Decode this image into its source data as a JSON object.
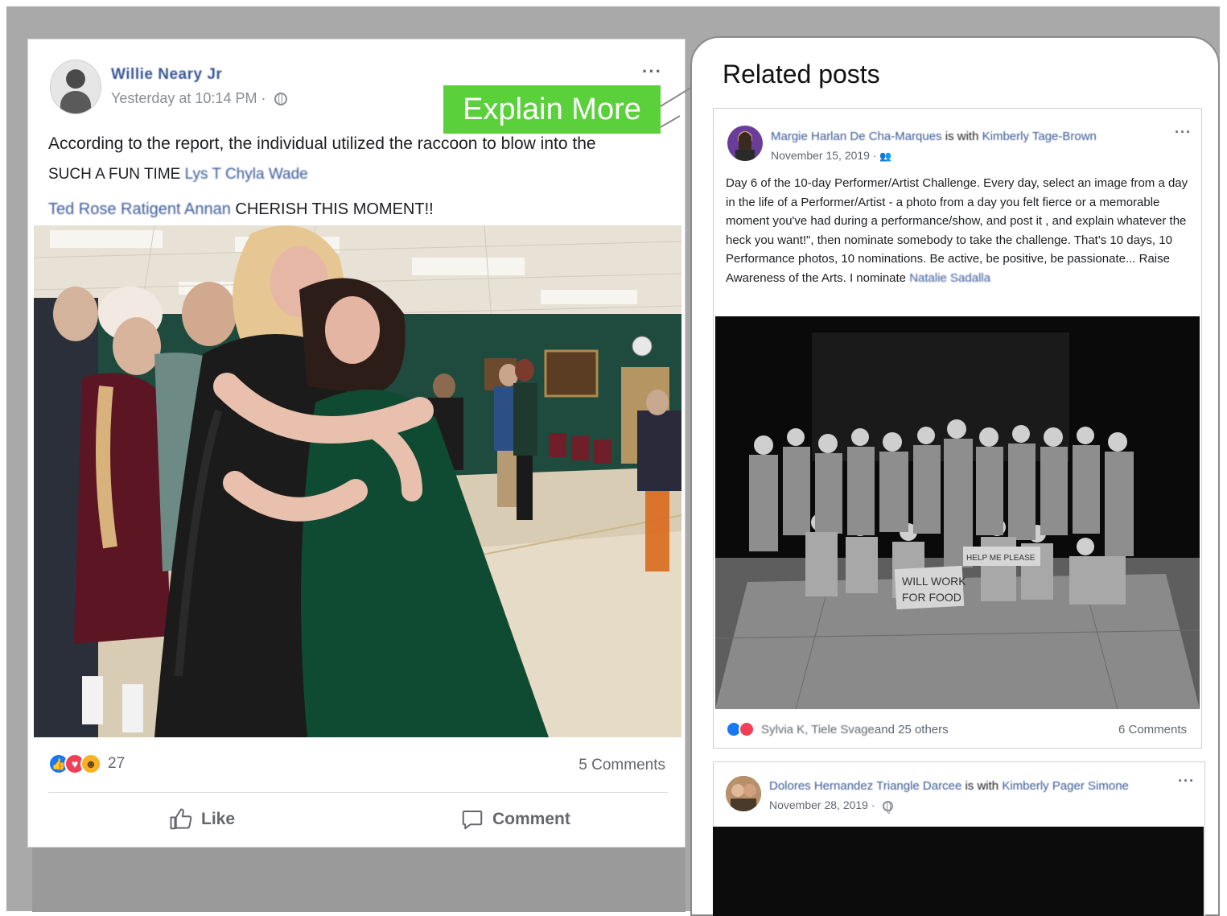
{
  "main_post": {
    "author": "Willie Neary Jr",
    "timestamp": "Yesterday at 10:14 PM · ",
    "text_line1": "According to the report, the individual utilized the raccoon to blow into the",
    "text_line2_prefix": "SUCH A FUN TIME ",
    "text_line2_mention": "Lys T Chyla Wade",
    "text_line3_mention": "Ted Rose Ratigent Annan",
    "text_line3_suffix": " CHERISH  THIS   MOMENT!!",
    "reaction_count": "27",
    "comments": "5 Comments",
    "like_label": "Like",
    "comment_label": "Comment",
    "more_label": "···"
  },
  "explain_button": {
    "label": "Explain More",
    "color": "#5ad13b"
  },
  "related": {
    "title": "Related posts",
    "posts": [
      {
        "author": "Margie Harlan De Cha-Marques",
        "with_label": " is with ",
        "with_name": "Kimberly Tage-Brown",
        "date": "November 15, 2019 · ",
        "text_main": "Day 6 of the 10-day Performer/Artist Challenge. Every day, select an image from a day in the life of a Performer/Artist - a photo from a day you felt fierce or a memorable moment you've had during a performance/show, and post it , and explain whatever the heck you want!\", then nominate somebody to take the challenge. That's 10 days, 10 Performance photos, 10 nominations. Be active, be positive, be passionate... Raise Awareness of the Arts. I nominate ",
        "text_mention": "Natalie Sadalla",
        "sign_text_1": "WILL WORK",
        "sign_text_2": "FOR FOOD",
        "sign_text_3": "HELP ME PLEASE",
        "reactors": "Sylvia K, Tiele Svage",
        "reactors_suffix": " and 25 others",
        "comments": "6 Comments",
        "more_label": "···"
      },
      {
        "author": "Dolores Hernandez Triangle Darcee",
        "with_label": " is with ",
        "with_name": "Kimberly Pager Simone",
        "date": "November 28, 2019 · ",
        "more_label": "···"
      }
    ]
  },
  "colors": {
    "link": "#3b5998",
    "backdrop": "#a9a9a9",
    "like_blue": "#1877f2",
    "love_red": "#f33e58",
    "haha_yellow": "#f7b125"
  }
}
